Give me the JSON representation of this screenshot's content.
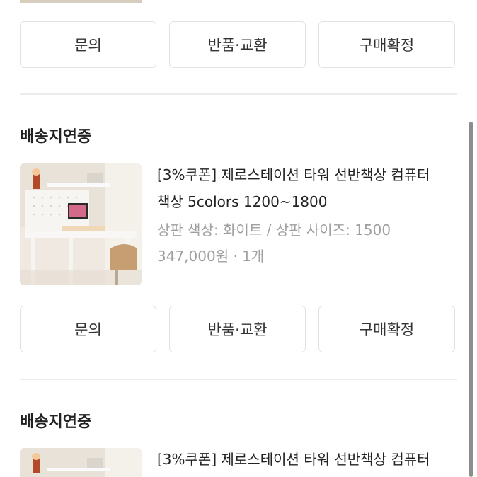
{
  "orders": [
    {
      "actions": [
        "문의",
        "반품·교환",
        "구매확정"
      ]
    },
    {
      "status": "배송지연중",
      "product": {
        "title": "[3%쿠폰] 제로스테이션 타워 선반책상 컴퓨터 책상 5colors 1200~1800",
        "title_line1": "[3%쿠폰] 제로스테이션 타워 선반책상 컴퓨터",
        "title_line2": "책상 5colors 1200~1800",
        "option": "상판 색상: 화이트 / 상판 사이즈: 1500",
        "price_qty": "347,000원 · 1개"
      },
      "actions": [
        "문의",
        "반품·교환",
        "구매확정"
      ]
    },
    {
      "status": "배송지연중",
      "product": {
        "title_line1": "[3%쿠폰] 제로스테이션 타워 선반책상 컴퓨터"
      }
    }
  ],
  "colors": {
    "button_border": "#e2e2e2",
    "muted_text": "#a0a0a0",
    "divider": "#ececec",
    "scrollbar": "#8d8d8d"
  },
  "icons": [
    "product-thumbnail"
  ]
}
